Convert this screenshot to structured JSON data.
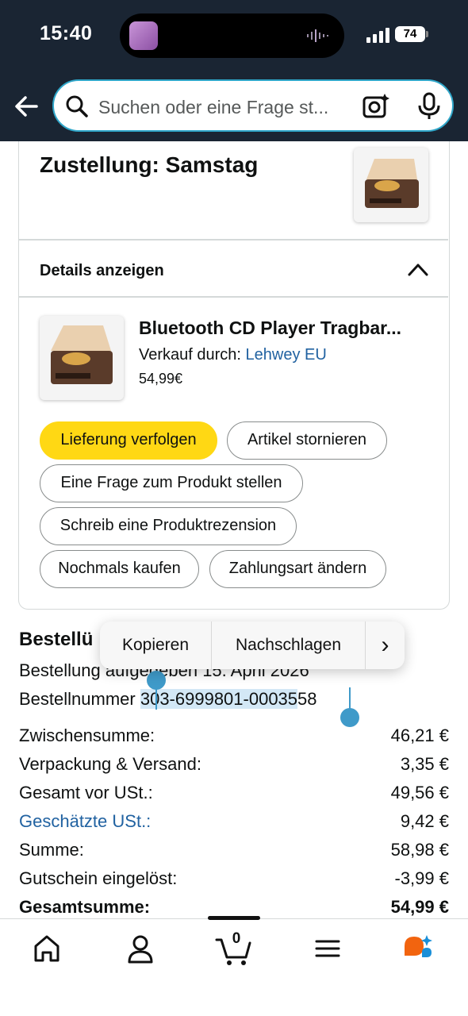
{
  "status_bar": {
    "time": "15:40",
    "battery": "74"
  },
  "search": {
    "placeholder": "Suchen oder eine Frage st..."
  },
  "delivery": {
    "title": "Zustellung: Samstag",
    "details_label": "Details anzeigen"
  },
  "product": {
    "title": "Bluetooth CD Player Tragbar...",
    "sold_by_label": "Verkauf durch: ",
    "seller": "Lehwey EU",
    "price": "54,99€"
  },
  "actions": {
    "track": "Lieferung verfolgen",
    "cancel": "Artikel stornieren",
    "question": "Eine Frage zum Produkt stellen",
    "review": "Schreib eine Produktrezension",
    "buy_again": "Nochmals kaufen",
    "change_payment": "Zahlungsart ändern"
  },
  "order": {
    "heading": "Bestellü",
    "placed": "Bestellung aufgegeben 15. April 2026",
    "number_label": "Bestellnummer ",
    "number_selected": "303-6999801-00035",
    "number_rest": "58"
  },
  "context_menu": {
    "copy": "Kopieren",
    "lookup": "Nachschlagen",
    "more": "›"
  },
  "summary": [
    {
      "label": "Zwischensumme:",
      "value": "46,21 €"
    },
    {
      "label": "Verpackung & Versand:",
      "value": "3,35 €"
    },
    {
      "label": "Gesamt vor USt.:",
      "value": "49,56 €"
    },
    {
      "label": "Geschätzte USt.:",
      "value": "9,42 €"
    },
    {
      "label": "Summe:",
      "value": "58,98 €"
    },
    {
      "label": "Gutschein eingelöst:",
      "value": "-3,99 €"
    },
    {
      "label": "Gesamtsumme:",
      "value": "54,99 €"
    }
  ],
  "nav": {
    "cart_count": "0"
  },
  "colors": {
    "header_bg": "#1a2533",
    "accent_yellow": "#ffd814",
    "link_blue": "#2162a1",
    "selection": "#3f9ac9"
  }
}
